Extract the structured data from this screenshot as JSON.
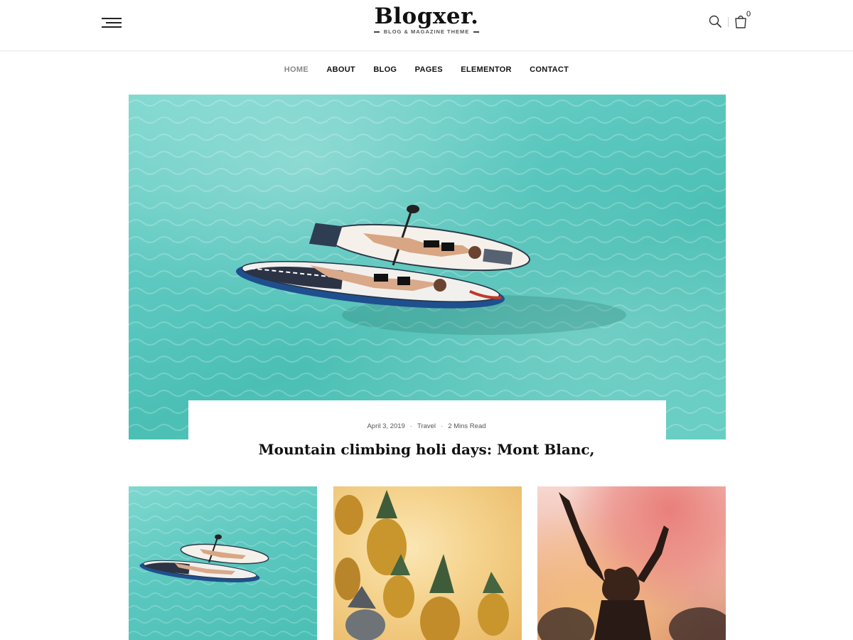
{
  "header": {
    "logo": {
      "name": "Blogxer.",
      "tagline": "BLOG & MAGAZINE THEME"
    },
    "icons": {
      "menu": "hamburger-menu-icon",
      "search": "search-icon",
      "cart": "shopping-bag-icon"
    },
    "cart_count": "0"
  },
  "nav": {
    "items": [
      {
        "label": "HOME",
        "active": true
      },
      {
        "label": "ABOUT",
        "active": false
      },
      {
        "label": "BLOG",
        "active": false
      },
      {
        "label": "PAGES",
        "active": false
      },
      {
        "label": "ELEMENTOR",
        "active": false
      },
      {
        "label": "CONTACT",
        "active": false
      }
    ]
  },
  "featured_post": {
    "date": "April 3, 2019",
    "category": "Travel",
    "read_time": "2 Mins Read",
    "title": "Mountain climbing holi days: Mont Blanc,"
  },
  "colors": {
    "water": "#5cc8bf",
    "text": "#111111",
    "nav_active": "#888888"
  }
}
